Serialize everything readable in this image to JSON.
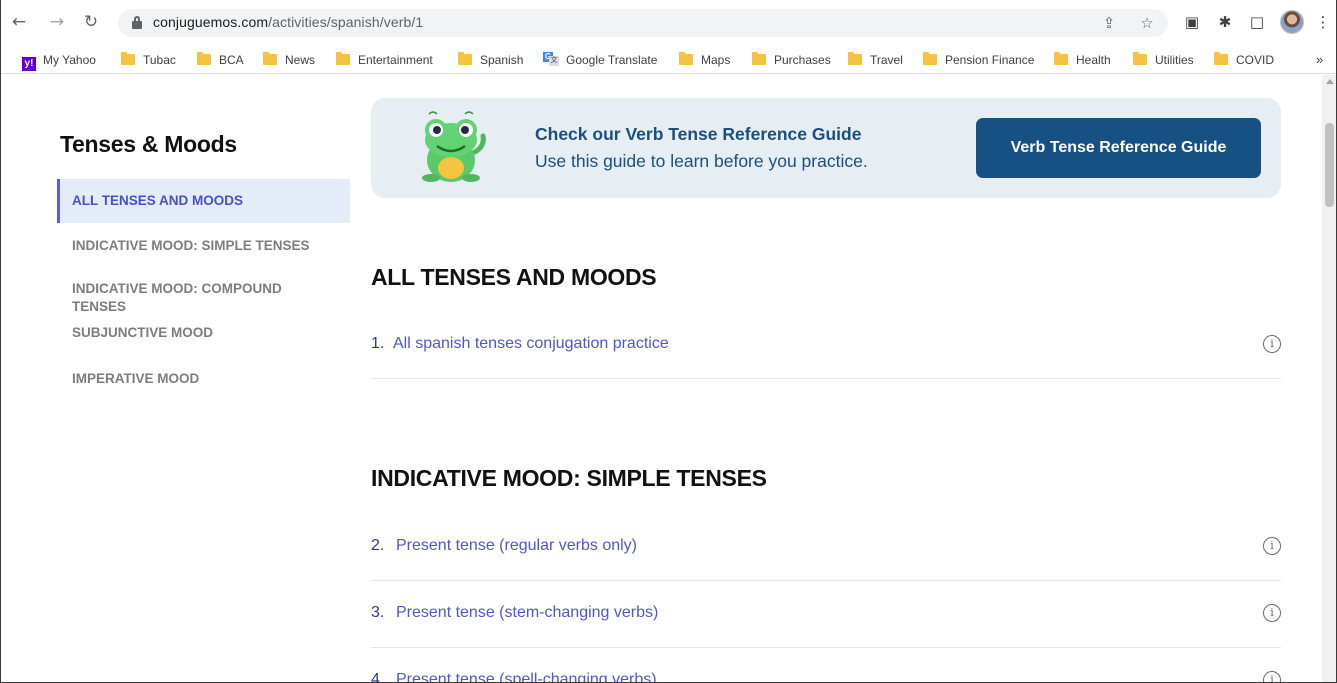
{
  "browser": {
    "url_host": "conjuguemos.com",
    "url_path": "/activities/spanish/verb/1",
    "bookmarks": [
      {
        "label": "My Yahoo",
        "icon": "yahoo-icon"
      },
      {
        "label": "Tubac",
        "icon": "folder-icon"
      },
      {
        "label": "BCA",
        "icon": "folder-icon"
      },
      {
        "label": "News",
        "icon": "folder-icon"
      },
      {
        "label": "Entertainment",
        "icon": "folder-icon"
      },
      {
        "label": "Spanish",
        "icon": "folder-icon"
      },
      {
        "label": "Google Translate",
        "icon": "google-translate-icon"
      },
      {
        "label": "Maps",
        "icon": "folder-icon"
      },
      {
        "label": "Purchases",
        "icon": "folder-icon"
      },
      {
        "label": "Travel",
        "icon": "folder-icon"
      },
      {
        "label": "Pension Finance",
        "icon": "folder-icon"
      },
      {
        "label": "Health",
        "icon": "folder-icon"
      },
      {
        "label": "Utilities",
        "icon": "folder-icon"
      },
      {
        "label": "COVID",
        "icon": "folder-icon"
      }
    ],
    "more_bookmarks": "»"
  },
  "sidebar": {
    "title": "Tenses & Moods",
    "items": [
      {
        "label": "ALL TENSES AND MOODS",
        "active": true
      },
      {
        "label": "INDICATIVE MOOD: SIMPLE TENSES",
        "active": false
      },
      {
        "label": "INDICATIVE MOOD: COMPOUND TENSES",
        "active": false
      },
      {
        "label": "SUBJUNCTIVE MOOD",
        "active": false
      },
      {
        "label": "IMPERATIVE MOOD",
        "active": false
      }
    ]
  },
  "banner": {
    "title": "Check our Verb Tense Reference Guide",
    "subtitle": "Use this guide to learn before you practice.",
    "button_label": "Verb Tense Reference Guide"
  },
  "sections": [
    {
      "title": "ALL TENSES AND MOODS",
      "rows": [
        {
          "num": "1.",
          "label": "All spanish tenses conjugation practice"
        }
      ]
    },
    {
      "title": "INDICATIVE MOOD: SIMPLE TENSES",
      "rows": [
        {
          "num": "2.",
          "label": "Present tense (regular verbs only)"
        },
        {
          "num": "3.",
          "label": "Present tense (stem-changing verbs)"
        },
        {
          "num": "4.",
          "label": "Present tense (spell-changing verbs)"
        }
      ]
    }
  ],
  "colors": {
    "accent": "#5156cf",
    "banner_bg": "#e6edf3",
    "button_bg": "#175082",
    "active_sidebar_bg": "#e3ecf7"
  }
}
